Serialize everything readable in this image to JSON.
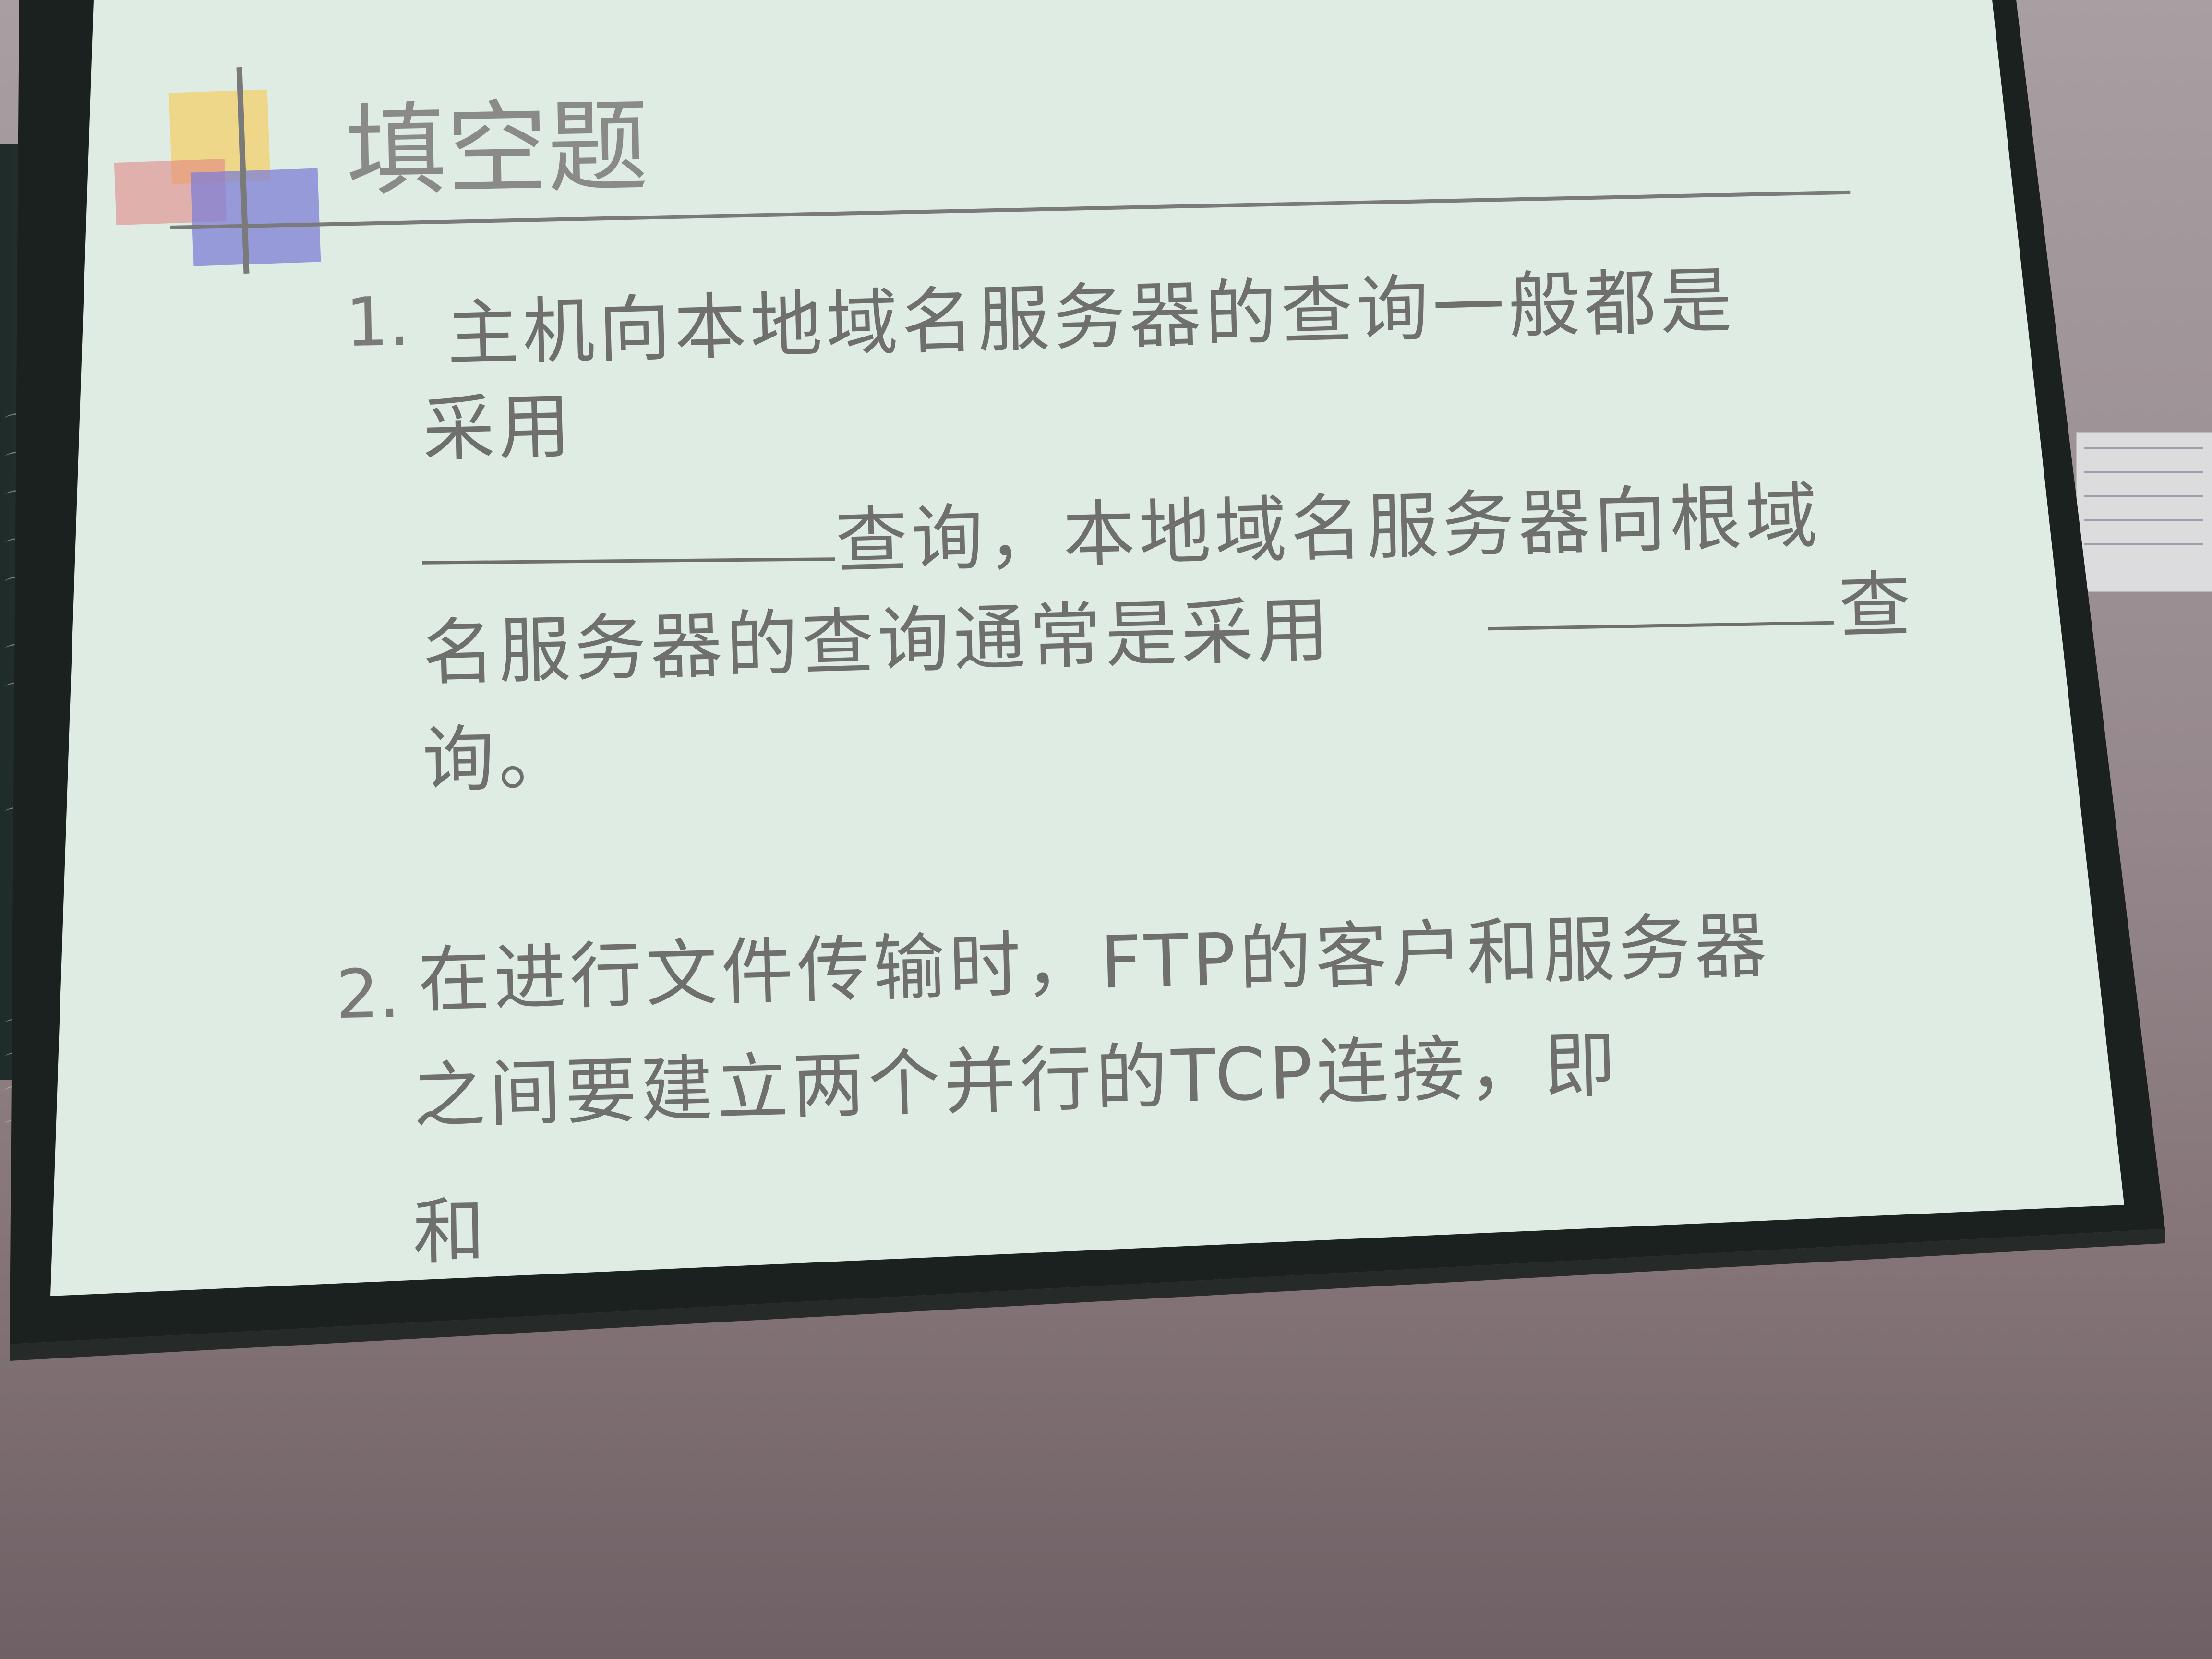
{
  "slide": {
    "title": "填空题",
    "q1": {
      "number": "1.",
      "line1": "主机向本地域名服务器的查询一般都是",
      "line2": "采用",
      "line3_after_blank": "查询，本地域名服务器向根域",
      "line4_before_blank": "名服务器的查询通常是采用",
      "line4_after_blank": "查",
      "line5": "询。"
    },
    "q2": {
      "number": "2.",
      "line1": "在进行文件传输时，FTP的客户和服务器",
      "line2": "之间要建立两个并行的TCP连接，即",
      "line3": "和"
    }
  },
  "colors": {
    "slide_background": "#dfece4",
    "text": "#6f6f6d",
    "deco_yellow": "#f2d37a",
    "deco_red": "#e08080",
    "deco_blue": "#7f7fd6",
    "frame": "#1b211f"
  }
}
